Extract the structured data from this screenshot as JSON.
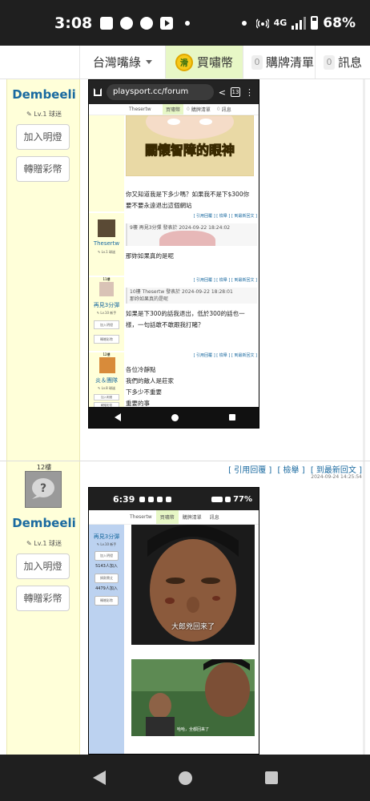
{
  "status_bar": {
    "time": "3:08",
    "network": "4G",
    "battery": "68%",
    "notification_icons": [
      "gallery-icon",
      "line-icon",
      "chat-icon",
      "youtube-icon"
    ]
  },
  "top_nav": {
    "region": "台灣嘴綠",
    "coin_icon_text": "滑",
    "coin_label": "買嘯幣",
    "cart_count": "0",
    "cart_label": "購牌清單",
    "msg_count": "0",
    "msg_label": "訊息"
  },
  "post1": {
    "user": {
      "name": "Dembeeli",
      "level": "✎ Lv.1 球迷",
      "btn_light": "加入明燈",
      "btn_gift": "轉贈彩幣"
    },
    "screenshot": {
      "url": "playsport.cc/forum",
      "tab_count": "13",
      "nav_user": "Thesertw",
      "nav_coin": "買嘯幣",
      "nav_cart_count": "0",
      "nav_cart": "購牌清單",
      "nav_msg_count": "0",
      "nav_msg": "訊息",
      "caption": "關懷智障的眼神",
      "text1_line1": "你又知道我是下多少嗎？如果我不是下$300你",
      "text1_line2": "要不要永遠退出這個網站",
      "reply1": {
        "links": "[ 引用回覆 ] [ 檢舉 ] [ 到最新回文 ]",
        "name": "Thesertw",
        "level": "✎ Lv.1 球迷",
        "quote": "9樓 再見3分彈 發表於 2024-09-22 18:24:02",
        "text": "那妳如果真的是呢"
      },
      "reply2": {
        "floor": "11樓",
        "links": "[ 引用回覆 ] [ 檢舉 ] [ 到最新回文 ]",
        "name": "再見3分彈",
        "level": "✎ Lv.10 新手",
        "btn_light": "加入明燈",
        "btn_gift": "轉贈彩幣",
        "quote_head": "10樓 Thesertw 發表於 2024-09-22 18:28:01",
        "quote_body": "那妳如果真的是呢",
        "text_line1": "如果是下300的話我退出，低於300的話也一",
        "text_line2": "樣，一句話敢不敢跟我打賭？"
      },
      "reply3": {
        "floor": "12樓",
        "links": "[ 引用回覆 ] [ 檢舉 ] [ 到最新回文 ]",
        "name": "炎＆團隊",
        "level": "✎ Lv.8 球迷",
        "btn_light": "加入明燈",
        "btn_gift": "轉贈彩幣",
        "lines": [
          "各位冷靜點",
          "我們的敵人是莊家",
          "下多少不重要",
          "重要的事"
        ]
      }
    }
  },
  "post2": {
    "floor": "12樓",
    "links": [
      "[ 引用回覆 ]",
      "[ 檢舉 ]",
      "[ 到最新回文 ]"
    ],
    "date": "2024-09-24 14:25:54",
    "user": {
      "name": "Dembeeli",
      "level": "✎ Lv.1 球迷",
      "btn_light": "加入明燈",
      "btn_gift": "轉贈彩幣"
    },
    "screenshot": {
      "time": "6:39",
      "battery": "77%",
      "nav_user": "Thesertw",
      "nav_coin": "買嘯幣",
      "nav_cart": "購牌清單",
      "nav_msg": "訊息",
      "side_name": "再見3分彈",
      "side_level": "✎ Lv.10 新手",
      "btn_light": "加入明燈",
      "stat1": "5143人加入",
      "btn_fund": "捐款贊丈",
      "stat2": "4479人加入",
      "btn_gift": "轉贈彩幣",
      "caption1": "大郎兇回来了",
      "caption2": "哈哈，全都回来了"
    }
  }
}
